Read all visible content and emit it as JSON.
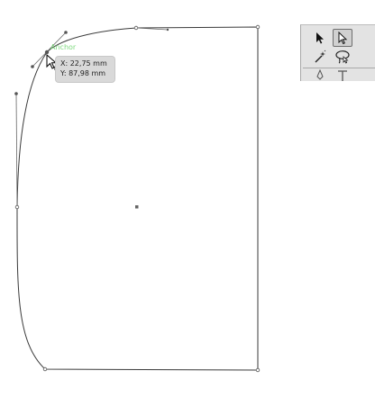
{
  "tooltip": {
    "x_readout": "X: 22,75 mm",
    "y_readout": "Y: 87,98 mm"
  },
  "anchor_hint": "Anchor",
  "tools": [
    {
      "name": "selection-tool",
      "icon": "black-arrow-icon",
      "selected": false
    },
    {
      "name": "direct-selection-tool",
      "icon": "white-arrow-icon",
      "selected": true
    },
    {
      "name": "magic-wand-tool",
      "icon": "magic-wand-icon",
      "selected": false
    },
    {
      "name": "lasso-tool",
      "icon": "lasso-icon",
      "selected": false
    },
    {
      "name": "pen-tool",
      "icon": "pen-icon",
      "selected": false
    },
    {
      "name": "type-tool",
      "icon": "type-icon",
      "selected": false
    }
  ],
  "colors": {
    "path_stroke": "#3a3a3a",
    "anchor_hint": "#7fd97f",
    "tooltip_bg": "#d9d9d9"
  }
}
